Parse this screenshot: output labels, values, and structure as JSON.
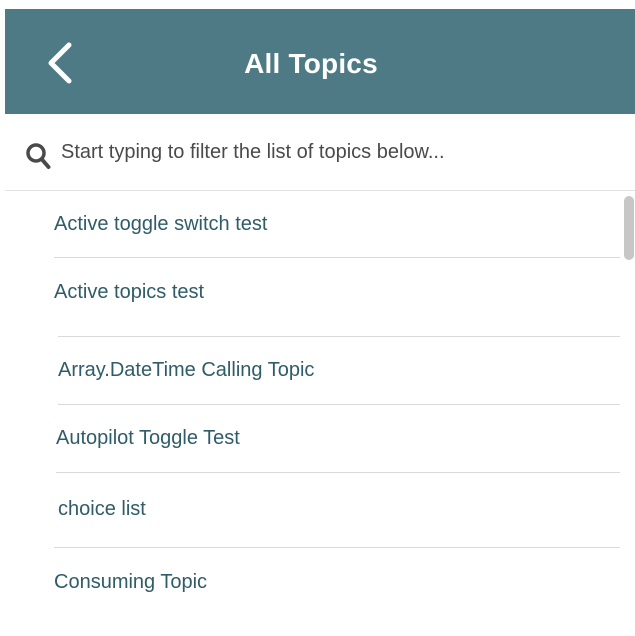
{
  "header": {
    "title": "All Topics",
    "back_icon": "chevron-left-icon",
    "background_color": "#4d7a85"
  },
  "search": {
    "icon": "search-icon",
    "placeholder": "Start typing to filter the list of topics below..."
  },
  "topics": [
    "Active toggle switch test",
    "Active topics test",
    "Array.DateTime Calling Topic",
    "Autopilot Toggle Test",
    "choice list",
    "Consuming Topic"
  ],
  "colors": {
    "topic_text": "#2f5c68",
    "divider": "#d9d9d9"
  }
}
